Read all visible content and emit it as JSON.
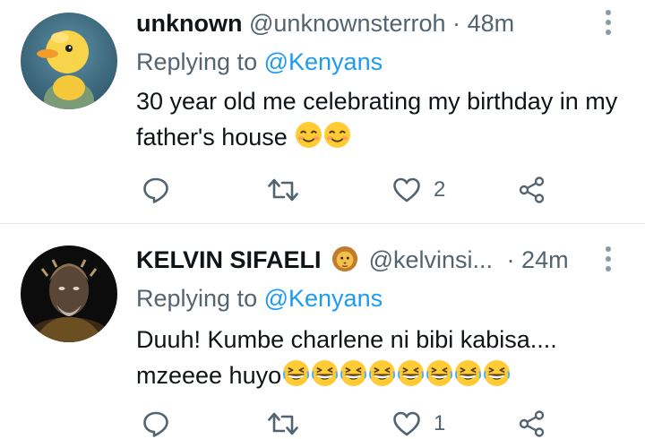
{
  "tweets": [
    {
      "name": "unknown",
      "handle": "@unknownsterroh",
      "separator": "·",
      "time": "48m",
      "replying_prefix": "Replying to",
      "replying_to": "@Kenyans",
      "text": "30 year old me celebrating my birthday in my father's house",
      "emojis": [
        "smiling-face-emoji",
        "smiling-face-emoji"
      ],
      "like_count": "2",
      "avatar": "yellow-duckling-avatar"
    },
    {
      "name": "KELVIN SIFAELI",
      "name_badge": "lion-face-emoji",
      "handle": "@kelvinsi...",
      "separator": "·",
      "time": "24m",
      "replying_prefix": "Replying to",
      "replying_to": "@Kenyans",
      "text_line1": "Duuh! Kumbe charlene ni bibi kabisa....",
      "text_line2": "mzeeee huyo",
      "emojis": [
        "grinning-squinting-face-emoji",
        "grinning-squinting-face-emoji",
        "grinning-squinting-face-emoji",
        "grinning-squinting-face-emoji",
        "grinning-squinting-face-emoji",
        "grinning-squinting-face-emoji",
        "grinning-squinting-face-emoji",
        "grinning-squinting-face-emoji"
      ],
      "like_count": "1",
      "avatar": "dark-warrior-portrait-avatar"
    }
  ],
  "colors": {
    "text": "#0f1419",
    "secondary": "#536471",
    "link": "#1d9bf0",
    "divider": "#e6e6e6",
    "emoji": "#ffcc33"
  }
}
